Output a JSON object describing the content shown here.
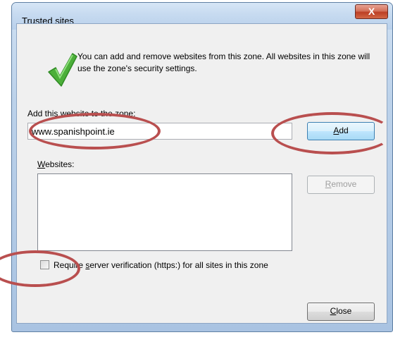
{
  "window": {
    "title": "Trusted sites",
    "close_glyph": "X"
  },
  "info": {
    "icon": "green-checkmark",
    "text": "You can add and remove websites from this zone. All websites in this zone will use the zone's security settings."
  },
  "add_section": {
    "label": "Add this website to the zone:",
    "input_value": "www.spanishpoint.ie",
    "add_button": {
      "mnemonic": "A",
      "rest": "dd"
    }
  },
  "websites": {
    "label_mnemonic": "W",
    "label_rest": "ebsites:",
    "items": [],
    "remove_button": {
      "mnemonic": "R",
      "rest": "emove"
    }
  },
  "verification": {
    "checked": false,
    "label_pre": "Requ",
    "label_mid": "ire ",
    "mnemonic": "s",
    "label_post": "erver verification (https:) for all sites in this zone"
  },
  "close_button": {
    "mnemonic": "C",
    "rest": "lose"
  },
  "colors": {
    "annotation": "#b94f4f",
    "checkmark": "#4caf3a",
    "close_button": "#c7462a"
  }
}
